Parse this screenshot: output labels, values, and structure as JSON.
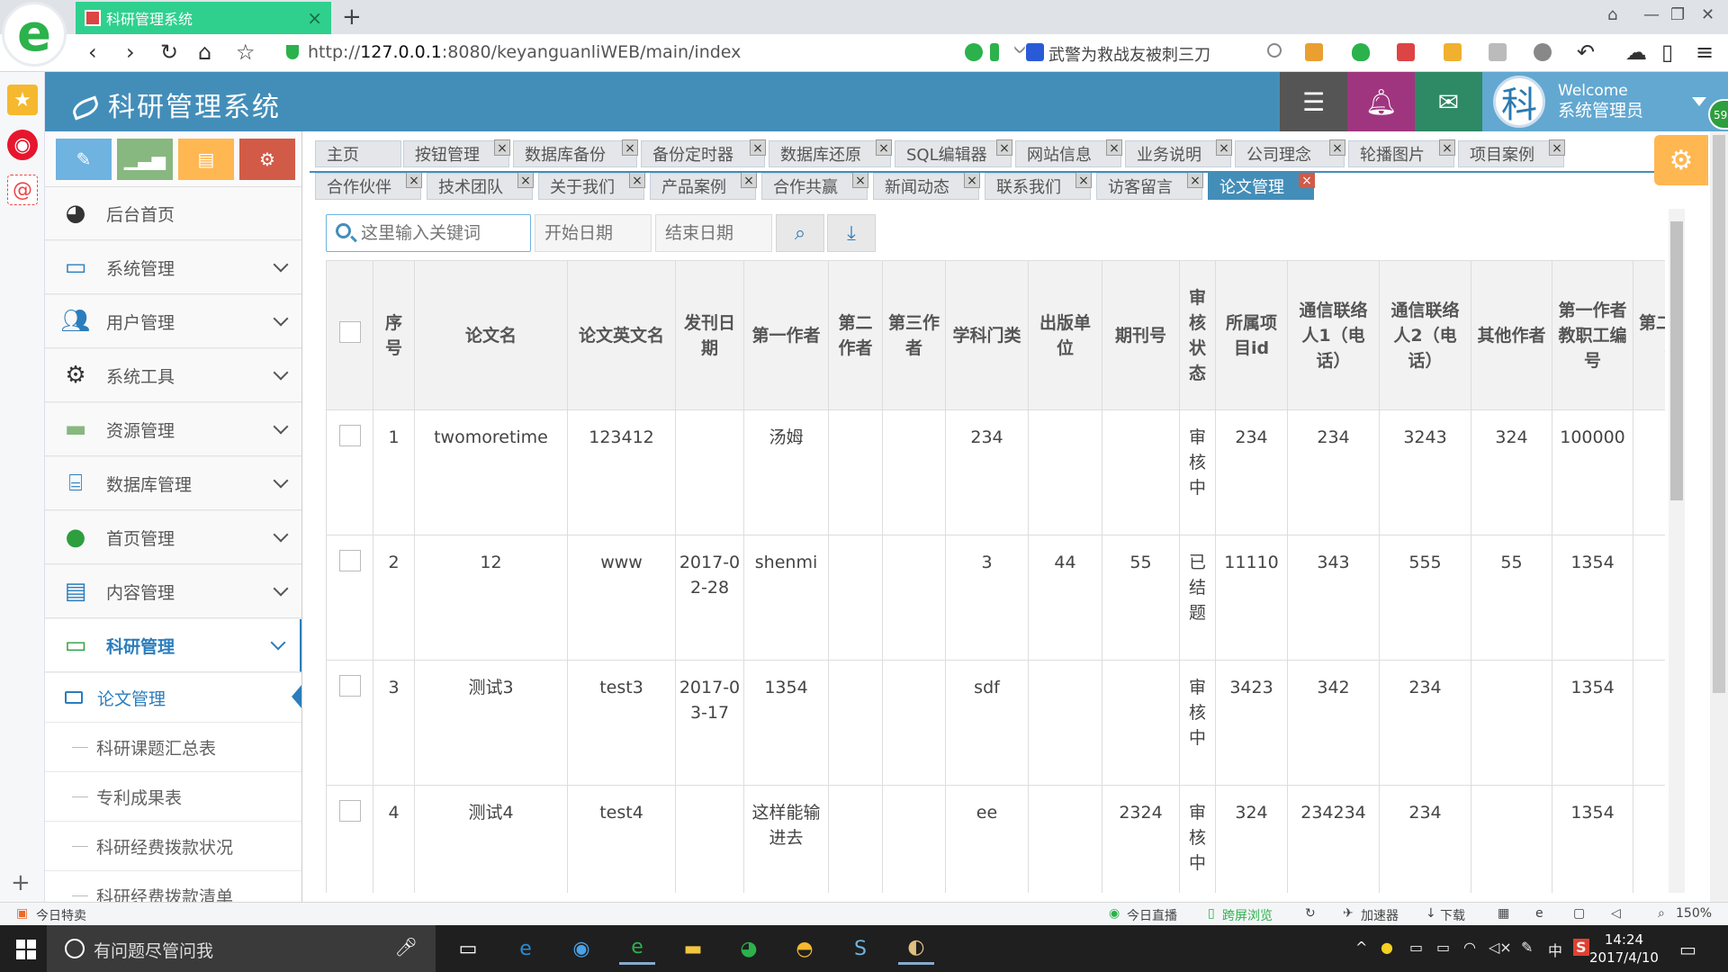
{
  "browser": {
    "tab_title": "科研管理系统",
    "url_prefix": "http://",
    "url_host": "127.0.0.1",
    "url_rest": ":8080/keyanguanliWEB/main/index",
    "news_text": "武警为救战友被刺三刀"
  },
  "app": {
    "title": "科研管理系统",
    "avatar_char": "科",
    "welcome": "Welcome",
    "username": "系统管理员",
    "badge": "59"
  },
  "sidebar": {
    "shortcut_colors": [
      "#6fb3e0",
      "#87b87f",
      "#ffb752",
      "#d15b47"
    ],
    "menus": [
      {
        "label": "后台首页"
      },
      {
        "label": "系统管理"
      },
      {
        "label": "用户管理"
      },
      {
        "label": "系统工具"
      },
      {
        "label": "资源管理"
      },
      {
        "label": "数据库管理"
      },
      {
        "label": "首页管理"
      },
      {
        "label": "内容管理"
      },
      {
        "label": "科研管理"
      }
    ],
    "submenus": [
      {
        "label": "论文管理"
      },
      {
        "label": "科研课题汇总表"
      },
      {
        "label": "专利成果表"
      },
      {
        "label": "科研经费拨款状况"
      },
      {
        "label": "科研经费拨款清单"
      }
    ]
  },
  "tabs": {
    "row1": [
      "主页",
      "按钮管理",
      "数据库备份",
      "备份定时器",
      "数据库还原",
      "SQL编辑器",
      "网站信息",
      "业务说明",
      "公司理念",
      "轮播图片",
      "项目案例"
    ],
    "row2": [
      "合作伙伴",
      "技术团队",
      "关于我们",
      "产品案例",
      "合作共赢",
      "新闻动态",
      "联系我们",
      "访客留言",
      "论文管理"
    ],
    "close": "×"
  },
  "toolbar": {
    "search_placeholder": "这里输入关键词",
    "start_placeholder": "开始日期",
    "end_placeholder": "结束日期"
  },
  "table": {
    "columns": [
      "序号",
      "论文名",
      "论文英文名",
      "发刊日期",
      "第一作者",
      "第二作者",
      "第三作者",
      "学科门类",
      "出版单位",
      "期刊号",
      "审核状态",
      "所属项目id",
      "通信联络人1（电话）",
      "通信联络人2（电话）",
      "其他作者",
      "第一作者教职工编号",
      "第二作者教职工"
    ],
    "rows": [
      [
        "1",
        "twomoretime",
        "123412",
        "",
        "汤姆",
        "",
        "",
        "234",
        "",
        "",
        "审核中",
        "234",
        "234",
        "3243",
        "324",
        "100000",
        ""
      ],
      [
        "2",
        "12",
        "www",
        "2017-02-28",
        "shenmi",
        "",
        "",
        "3",
        "44",
        "55",
        "已结题",
        "11110",
        "343",
        "555",
        "55",
        "1354",
        ""
      ],
      [
        "3",
        "测试3",
        "test3",
        "2017-03-17",
        "1354",
        "",
        "",
        "sdf",
        "",
        "",
        "审核中",
        "3423",
        "342",
        "234",
        "",
        "1354",
        ""
      ],
      [
        "4",
        "测试4",
        "test4",
        "",
        "这样能输进去",
        "",
        "",
        "ee",
        "",
        "2324",
        "审核中",
        "324",
        "234234",
        "234",
        "",
        "1354",
        ""
      ]
    ]
  },
  "statusbar": {
    "left": "今日特卖",
    "live": "今日直播",
    "cross": "跨屏浏览",
    "accel": "加速器",
    "download": "下载",
    "zoom": "150%"
  },
  "taskbar": {
    "search_text": "有问题尽管问我",
    "time": "14:24",
    "date": "2017/4/10",
    "ime": "中"
  }
}
